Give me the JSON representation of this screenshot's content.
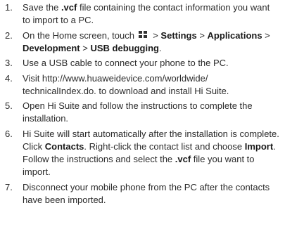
{
  "steps": [
    {
      "number": "1.",
      "parts": [
        "Save the ",
        ".vcf",
        " file containing the contact information you want to import to a PC."
      ]
    },
    {
      "number": "2.",
      "parts": [
        "On the Home screen, touch ",
        " > ",
        "Settings",
        " > ",
        "Applications",
        " > ",
        "Development",
        " > ",
        "USB debugging",
        "."
      ],
      "icon": "app-grid-icon"
    },
    {
      "number": "3.",
      "parts": [
        "Use a USB cable to connect your phone to the PC."
      ]
    },
    {
      "number": "4.",
      "parts": [
        "Visit http://www.huaweidevice.com/worldwide/ technicalIndex.do. to download and install Hi Suite."
      ]
    },
    {
      "number": "5.",
      "parts": [
        "Open Hi Suite and follow the instructions to complete the installation."
      ]
    },
    {
      "number": "6.",
      "parts": [
        "Hi Suite will start automatically after the installation is complete. Click ",
        "Contacts",
        ". Right-click the contact list and choose ",
        "Import",
        ". Follow the instructions and select the ",
        ".vcf",
        " file you want to import."
      ]
    },
    {
      "number": "7.",
      "parts": [
        "Disconnect your mobile phone from the PC after the contacts have been imported."
      ]
    }
  ]
}
